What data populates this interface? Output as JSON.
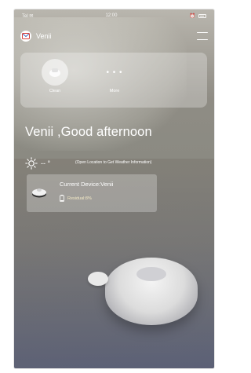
{
  "status_bar": {
    "signal": "Tel ✉",
    "time": "12:00"
  },
  "header": {
    "app_name": "Venii"
  },
  "actions": [
    {
      "label": "Clean",
      "icon": "robot-vacuum-icon"
    },
    {
      "label": "More",
      "icon": "more-dots-icon",
      "glyph": "• • •"
    }
  ],
  "greeting": "Venii ,Good afternoon",
  "weather": {
    "icon": "sun-icon",
    "temp": "-- °",
    "hint": "(Open Location to Get Weather Information)"
  },
  "device": {
    "name": "Current Device:Venii",
    "residual": "Residual:8%",
    "battery_level": 8,
    "thumb_icon": "robot-vacuum-icon"
  },
  "colors": {
    "residual_text": "#f3e9c6"
  }
}
